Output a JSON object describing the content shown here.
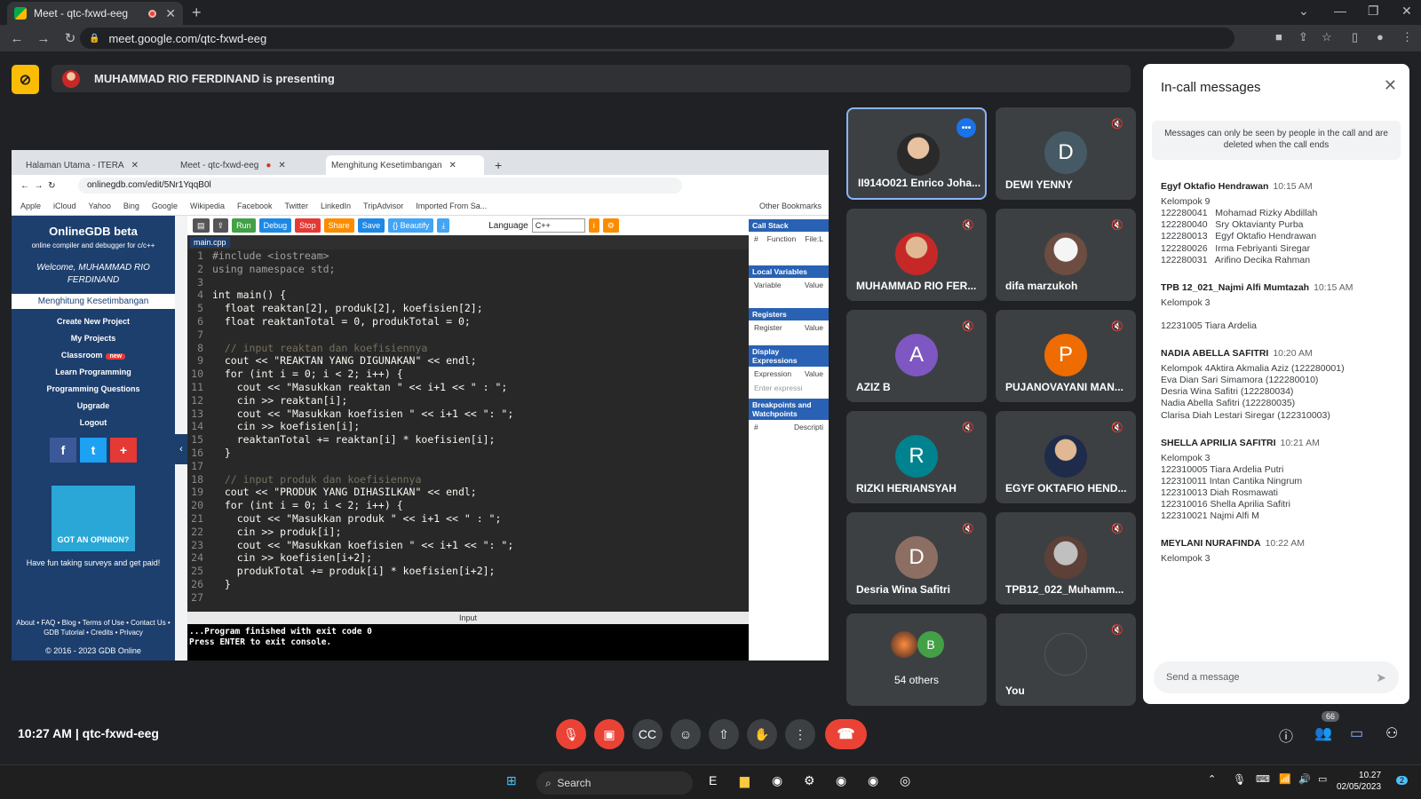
{
  "browser": {
    "tab_title": "Meet - qtc-fxwd-eeg",
    "url": "meet.google.com/qtc-fxwd-eeg"
  },
  "presenting": {
    "text": "MUHAMMAD RIO FERDINAND is presenting"
  },
  "shared_screen": {
    "tabs": [
      "Halaman Utama - ITERA",
      "Meet - qtc-fxwd-eeg",
      "Menghitung Kesetimbangan"
    ],
    "url": "onlinegdb.com/edit/5Nr1YqqB0l",
    "bookmarks": [
      "Apple",
      "iCloud",
      "Yahoo",
      "Bing",
      "Google",
      "Wikipedia",
      "Facebook",
      "Twitter",
      "LinkedIn",
      "TripAdvisor",
      "Imported From Sa...",
      "Other Bookmarks"
    ],
    "sidebar": {
      "logo": "OnlineGDB beta",
      "tagline": "online compiler and debugger for c/c++",
      "welcome": "Welcome, MUHAMMAD RIO FERDINAND",
      "active": "Menghitung Kesetimbangan",
      "links": [
        "Create New Project",
        "My Projects",
        "Classroom",
        "Learn Programming",
        "Programming Questions",
        "Upgrade",
        "Logout"
      ],
      "classroom_badge": "new",
      "ad_title": "GOT AN OPINION?",
      "ad_text": "Have fun taking surveys and get paid!",
      "footer": "About • FAQ • Blog • Terms of Use • Contact Us • GDB Tutorial • Credits • Privacy",
      "copyright": "© 2016 - 2023 GDB Online"
    },
    "toolbar": {
      "run": "Run",
      "debug": "Debug",
      "stop": "Stop",
      "share": "Share",
      "save": "Save",
      "beautify": "{} Beautify",
      "language_label": "Language",
      "language_value": "C++"
    },
    "filename": "main.cpp",
    "code": [
      "#include <iostream>",
      "using namespace std;",
      "",
      "int main() {",
      "  float reaktan[2], produk[2], koefisien[2];",
      "  float reaktanTotal = 0, produkTotal = 0;",
      "",
      "  // input reaktan dan koefisiennya",
      "  cout << \"REAKTAN YANG DIGUNAKAN\" << endl;",
      "  for (int i = 0; i < 2; i++) {",
      "    cout << \"Masukkan reaktan \" << i+1 << \" : \";",
      "    cin >> reaktan[i];",
      "    cout << \"Masukkan koefisien \" << i+1 << \": \";",
      "    cin >> koefisien[i];",
      "    reaktanTotal += reaktan[i] * koefisien[i];",
      "  }",
      "",
      "  // input produk dan koefisiennya",
      "  cout << \"PRODUK YANG DIHASILKAN\" << endl;",
      "  for (int i = 0; i < 2; i++) {",
      "    cout << \"Masukkan produk \" << i+1 << \" : \";",
      "    cin >> produk[i];",
      "    cout << \"Masukkan koefisien \" << i+1 << \": \";",
      "    cin >> koefisien[i+2];",
      "    produkTotal += produk[i] * koefisien[i+2];",
      "  }",
      ""
    ],
    "input_label": "Input",
    "console": [
      "...Program finished with exit code 0",
      "Press ENTER to exit console."
    ],
    "debugger": {
      "call_stack": "Call Stack",
      "call_cols": [
        "#",
        "Function",
        "File:L"
      ],
      "locals": "Local Variables",
      "local_cols": [
        "Variable",
        "Value"
      ],
      "registers": "Registers",
      "reg_cols": [
        "Register",
        "Value"
      ],
      "display": "Display Expressions",
      "expr_cols": [
        "Expression",
        "Value"
      ],
      "expr_placeholder": "Enter expressi",
      "breakpoints": "Breakpoints and Watchpoints",
      "bp_cols": [
        "#",
        "Descripti"
      ]
    }
  },
  "participants": [
    {
      "name": "II914O021 Enrico Joha...",
      "type": "photo",
      "speaking": true
    },
    {
      "name": "DEWI YENNY",
      "type": "initial",
      "initial": "D",
      "color": "#455a64"
    },
    {
      "name": "MUHAMMAD RIO FER...",
      "type": "photo"
    },
    {
      "name": "difa marzukoh",
      "type": "photo"
    },
    {
      "name": "AZIZ B",
      "type": "initial",
      "initial": "A",
      "color": "#7e57c2"
    },
    {
      "name": "PUJANOVAYANI MAN...",
      "type": "initial",
      "initial": "P",
      "color": "#ef6c00"
    },
    {
      "name": "RIZKI HERIANSYAH",
      "type": "initial",
      "initial": "R",
      "color": "#00838f"
    },
    {
      "name": "EGYF OKTAFIO HEND...",
      "type": "photo"
    },
    {
      "name": "Desria Wina Safitri",
      "type": "initial",
      "initial": "D",
      "color": "#8d6e63"
    },
    {
      "name": "TPB12_022_Muhamm...",
      "type": "photo"
    },
    {
      "name": "54 others",
      "type": "group",
      "initial": "B"
    },
    {
      "name": "You",
      "type": "self"
    }
  ],
  "chat": {
    "title": "In-call messages",
    "note": "Messages can only be seen by people in the call and are deleted when the call ends",
    "messages": [
      {
        "sender": "Egyf Oktafio Hendrawan",
        "time": "10:15 AM",
        "lines": [
          "Kelompok 9",
          "122280041   Mohamad Rizky Abdillah",
          "122280040   Sry Oktavianty Purba",
          "122280013   Egyf Oktafio Hendrawan",
          "122280026   Irma Febriyanti Siregar",
          "122280031   Arifino Decika Rahman"
        ]
      },
      {
        "sender": "TPB 12_021_Najmi Alfi Mumtazah",
        "time": "10:15 AM",
        "lines": [
          "Kelompok 3",
          "",
          "12231005 Tiara Ardelia"
        ]
      },
      {
        "sender": "NADIA ABELLA SAFITRI",
        "time": "10:20 AM",
        "lines": [
          "Kelompok 4Aktira Akmalia Aziz (122280001)",
          "Eva Dian Sari Simamora (122280010)",
          "Desria Wina Safitri (122280034)",
          "Nadia Abella Safitri (122280035)",
          "Clarisa Diah Lestari Siregar (122310003)"
        ]
      },
      {
        "sender": "SHELLA APRILIA SAFITRI",
        "time": "10:21 AM",
        "lines": [
          "Kelompok 3",
          "122310005 Tiara Ardelia Putri",
          "122310011 Intan Cantika Ningrum",
          "122310013 Diah Rosmawati",
          "122310016 Shella Aprilia Safitri",
          "122310021 Najmi Alfi M"
        ]
      },
      {
        "sender": "MEYLANI NURAFINDA",
        "time": "10:22 AM",
        "lines": [
          "Kelompok 3"
        ]
      }
    ],
    "input_placeholder": "Send a message"
  },
  "bottom": {
    "time_meeting": "10:27 AM  |  qtc-fxwd-eeg",
    "people_count": "66"
  },
  "taskbar": {
    "search": "Search",
    "time": "10.27",
    "date": "02/05/2023",
    "notif": "2"
  }
}
